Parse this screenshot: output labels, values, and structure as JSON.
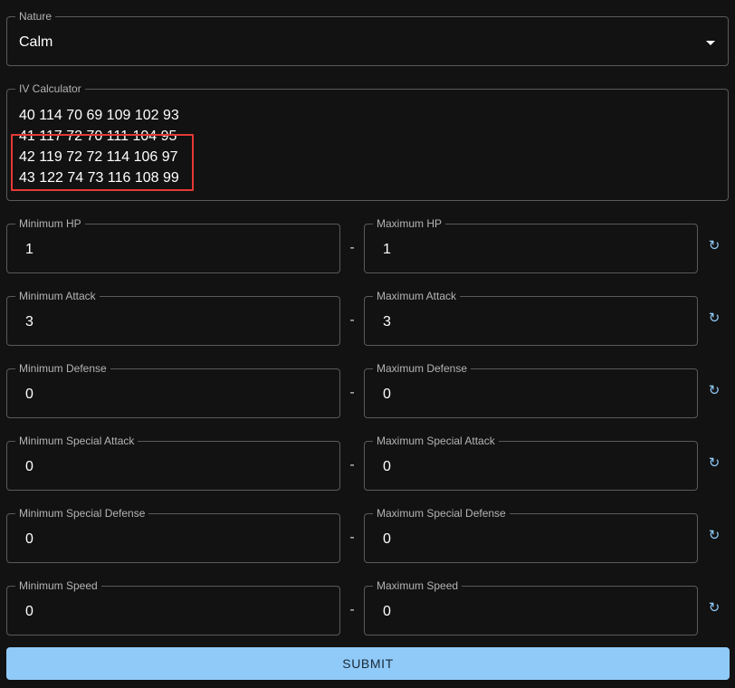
{
  "nature": {
    "label": "Nature",
    "value": "Calm"
  },
  "iv_calculator": {
    "label": "IV Calculator",
    "lines": [
      "40 114 70 69 109 102 93",
      "41 117 72 70 111 104 95",
      "42 119 72 72 114 106 97",
      "43 122 74 73 116 108 99"
    ]
  },
  "stats": [
    {
      "min_label": "Minimum HP",
      "min_value": "1",
      "max_label": "Maximum HP",
      "max_value": "1",
      "separator": "-"
    },
    {
      "min_label": "Minimum Attack",
      "min_value": "3",
      "max_label": "Maximum Attack",
      "max_value": "3",
      "separator": "-"
    },
    {
      "min_label": "Minimum Defense",
      "min_value": "0",
      "max_label": "Maximum Defense",
      "max_value": "0",
      "separator": "-"
    },
    {
      "min_label": "Minimum Special Attack",
      "min_value": "0",
      "max_label": "Maximum Special Attack",
      "max_value": "0",
      "separator": "-"
    },
    {
      "min_label": "Minimum Special Defense",
      "min_value": "0",
      "max_label": "Maximum Special Defense",
      "max_value": "0",
      "separator": "-"
    },
    {
      "min_label": "Minimum Speed",
      "min_value": "0",
      "max_label": "Maximum Speed",
      "max_value": "0",
      "separator": "-"
    }
  ],
  "reset_icon": "refresh-icon",
  "submit_label": "SUBMIT",
  "colors": {
    "background": "#121212",
    "outline": "#5a5a5a",
    "accent": "#90caf9",
    "highlight": "#e53935"
  }
}
